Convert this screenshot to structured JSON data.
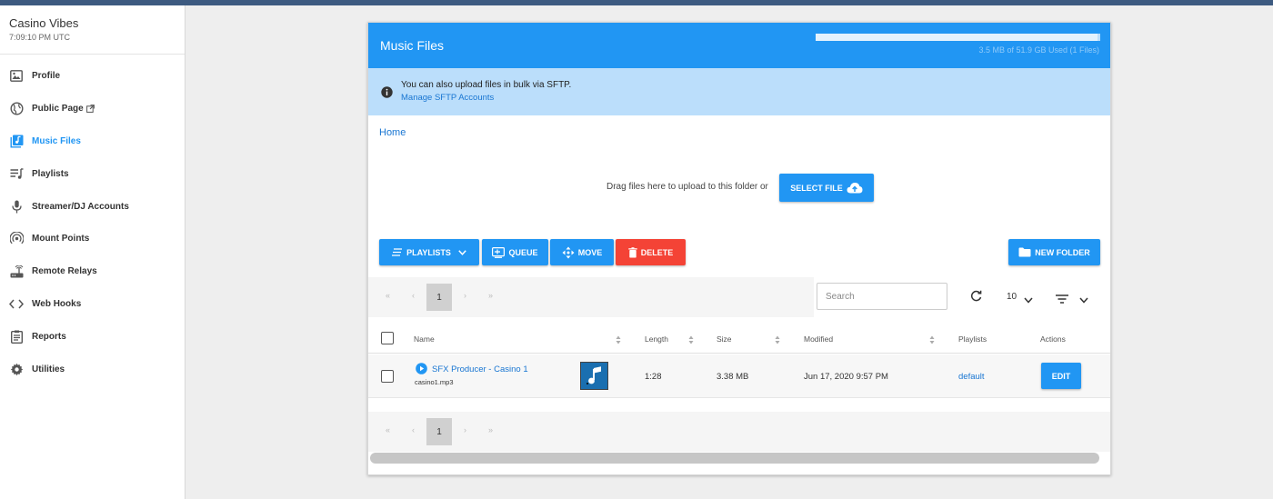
{
  "sidebar": {
    "station_name": "Casino Vibes",
    "station_time": "7:09:10 PM UTC",
    "items": [
      {
        "label": "Profile",
        "icon": "profile-icon"
      },
      {
        "label": "Public Page",
        "icon": "globe-icon"
      },
      {
        "label": "Music Files",
        "icon": "music-library-icon"
      },
      {
        "label": "Playlists",
        "icon": "playlist-icon"
      },
      {
        "label": "Streamer/DJ Accounts",
        "icon": "microphone-icon"
      },
      {
        "label": "Mount Points",
        "icon": "broadcast-icon"
      },
      {
        "label": "Remote Relays",
        "icon": "router-icon"
      },
      {
        "label": "Web Hooks",
        "icon": "code-icon"
      },
      {
        "label": "Reports",
        "icon": "clipboard-icon"
      },
      {
        "label": "Utilities",
        "icon": "gear-icon"
      }
    ],
    "active_item": "Music Files"
  },
  "card": {
    "title": "Music Files",
    "quota_text": "3.5 MB of 51.9 GB Used (1 Files)",
    "quota_fraction": 0.99
  },
  "info": {
    "text": "You can also upload files in bulk via SFTP.",
    "link": "Manage SFTP Accounts"
  },
  "breadcrumb": "Home",
  "upload": {
    "drag_text": "Drag files here to upload to this folder or",
    "select_label": "SELECT FILE"
  },
  "toolbar": {
    "playlists": "PLAYLISTS",
    "queue": "QUEUE",
    "move": "MOVE",
    "delete": "DELETE",
    "new_folder": "NEW FOLDER"
  },
  "pager": {
    "first": "«",
    "prev": "‹",
    "current": "1",
    "next": "›",
    "last": "»"
  },
  "search": {
    "placeholder": "Search"
  },
  "per_page": "10",
  "table": {
    "headers": {
      "name": "Name",
      "length": "Length",
      "size": "Size",
      "modified": "Modified",
      "playlists": "Playlists",
      "actions": "Actions"
    },
    "rows": [
      {
        "title": "SFX Producer - Casino 1",
        "file": "casino1.mp3",
        "length": "1:28",
        "size": "3.38 MB",
        "modified": "Jun 17, 2020 9:57 PM",
        "playlist": "default",
        "action": "EDIT"
      }
    ]
  },
  "colors": {
    "primary": "#2196f3",
    "danger": "#f44336",
    "info_bg": "#bbdefb"
  }
}
